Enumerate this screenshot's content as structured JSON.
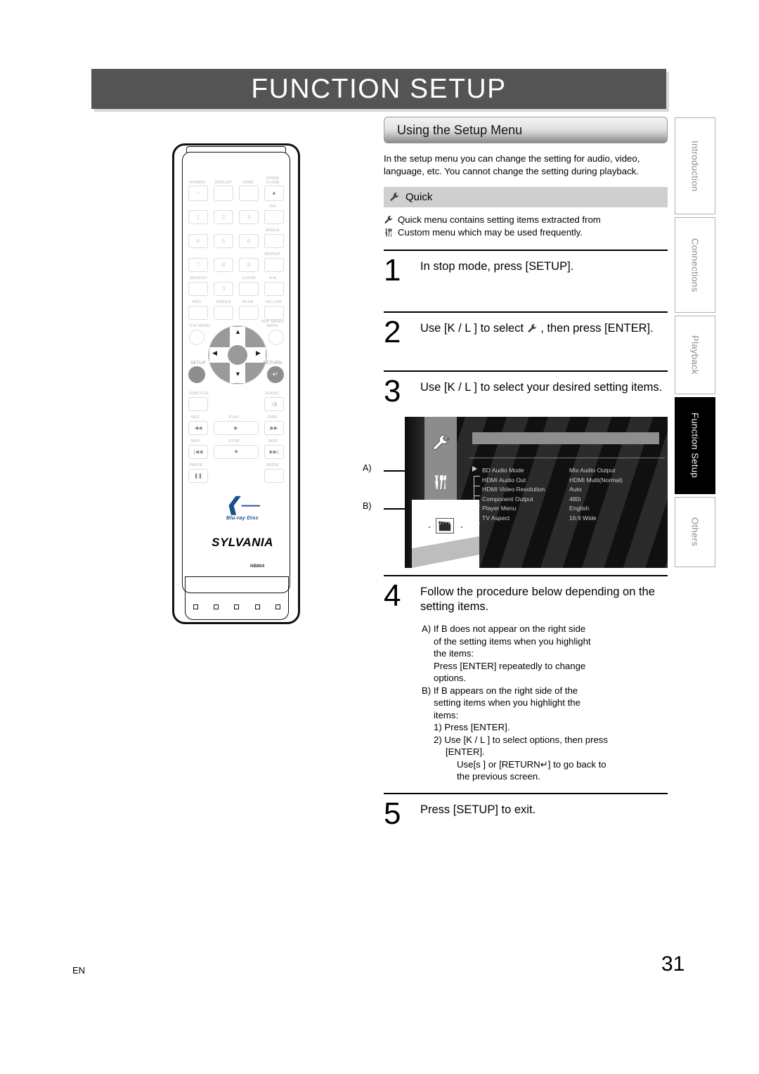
{
  "page": {
    "title": "FUNCTION SETUP",
    "footer_lang": "EN",
    "footer_page": "31",
    "accent_dark": "#545454",
    "accent_black": "#000000"
  },
  "tabs": [
    {
      "label": "Introduction",
      "active": false
    },
    {
      "label": "Connections",
      "active": false
    },
    {
      "label": "Playback",
      "active": false
    },
    {
      "label": "Function Setup",
      "active": true
    },
    {
      "label": "Others",
      "active": false
    }
  ],
  "remote": {
    "brand": "SYLVANIA",
    "model": "NB804",
    "disc_logo_text": "Blu-ray Disc",
    "labels": {
      "power": "POWER",
      "display": "DISPLAY",
      "hdmi": "HDMI",
      "open_close_1": "OPEN/",
      "open_close_2": "CLOSE",
      "pip": "PIP",
      "angle": "ANGLE",
      "repeat": "REPEAT",
      "search": "SEARCH",
      "clear": "CLEAR",
      "ab": "A-B",
      "red": "RED",
      "green": "GREEN",
      "blue": "BLUE",
      "yellow": "YELLOW",
      "top_menu": "TOP MENU",
      "pop_menu_1": "POP MENU/",
      "pop_menu_2": "MENU",
      "setup": "SETUP",
      "return": "RETURN",
      "subtitle": "SUBTITLE",
      "audio": "AUDIO",
      "rev": "REV",
      "play": "PLAY",
      "fwd": "FWD",
      "skip_left": "SKIP",
      "stop": "STOP",
      "skip_right": "SKIP",
      "pause": "PAUSE",
      "mode": "MODE"
    },
    "numbers": [
      "1",
      "2",
      "3",
      "4",
      "5",
      "6",
      "7",
      "8",
      "9",
      "0"
    ]
  },
  "section": {
    "heading": "Using the Setup Menu",
    "intro": "In the setup menu you can change the setting for audio, video, language, etc. You cannot change the setting during playback.",
    "quick_heading": "Quick",
    "quick_note_line1": "Quick  menu contains setting items extracted from",
    "quick_note_line2": "Custom  menu which may be used frequently."
  },
  "steps": [
    {
      "num": "1",
      "text": "In stop mode, press [SETUP]."
    },
    {
      "num": "2",
      "text_before": "Use [K / L ] to select",
      "text_after": ", then press [ENTER]."
    },
    {
      "num": "3",
      "text": "Use [K / L ] to select your desired setting items."
    },
    {
      "num": "4",
      "text": "Follow the procedure below depending on the setting items."
    },
    {
      "num": "5",
      "text": "Press [SETUP] to exit."
    }
  ],
  "setup_screen": {
    "callout_a": "A)",
    "callout_b": "B)",
    "rows": [
      {
        "name": "BD Audio Mode",
        "value": "Mix Audio Output"
      },
      {
        "name": "HDMI Audio Out",
        "value": "HDMI Multi(Normal)"
      },
      {
        "name": "HDMI Video Resolution",
        "value": "Auto"
      },
      {
        "name": "Component Output",
        "value": "480i"
      },
      {
        "name": "Player Menu",
        "value": "English"
      },
      {
        "name": "TV Aspect",
        "value": "16:9 Wide"
      }
    ]
  },
  "procedure": {
    "a_line1": "A) If  B    does not appear on the right side",
    "a_line2": "of the setting items when you highlight",
    "a_line3": "the items:",
    "a_line4": "Press [ENTER] repeatedly to change",
    "a_line5": "options.",
    "b_line1": "B) If  B    appears on the right side of the",
    "b_line2": "setting  items when you highlight the",
    "b_line3": "items:",
    "b_line4": "1) Press [ENTER].",
    "b_line5": "2) Use [K / L ] to select options, then press",
    "b_line6": "[ENTER].",
    "b_line7": "Use[s ] or [RETURN↵] to go back to",
    "b_line8": "the previous screen."
  }
}
